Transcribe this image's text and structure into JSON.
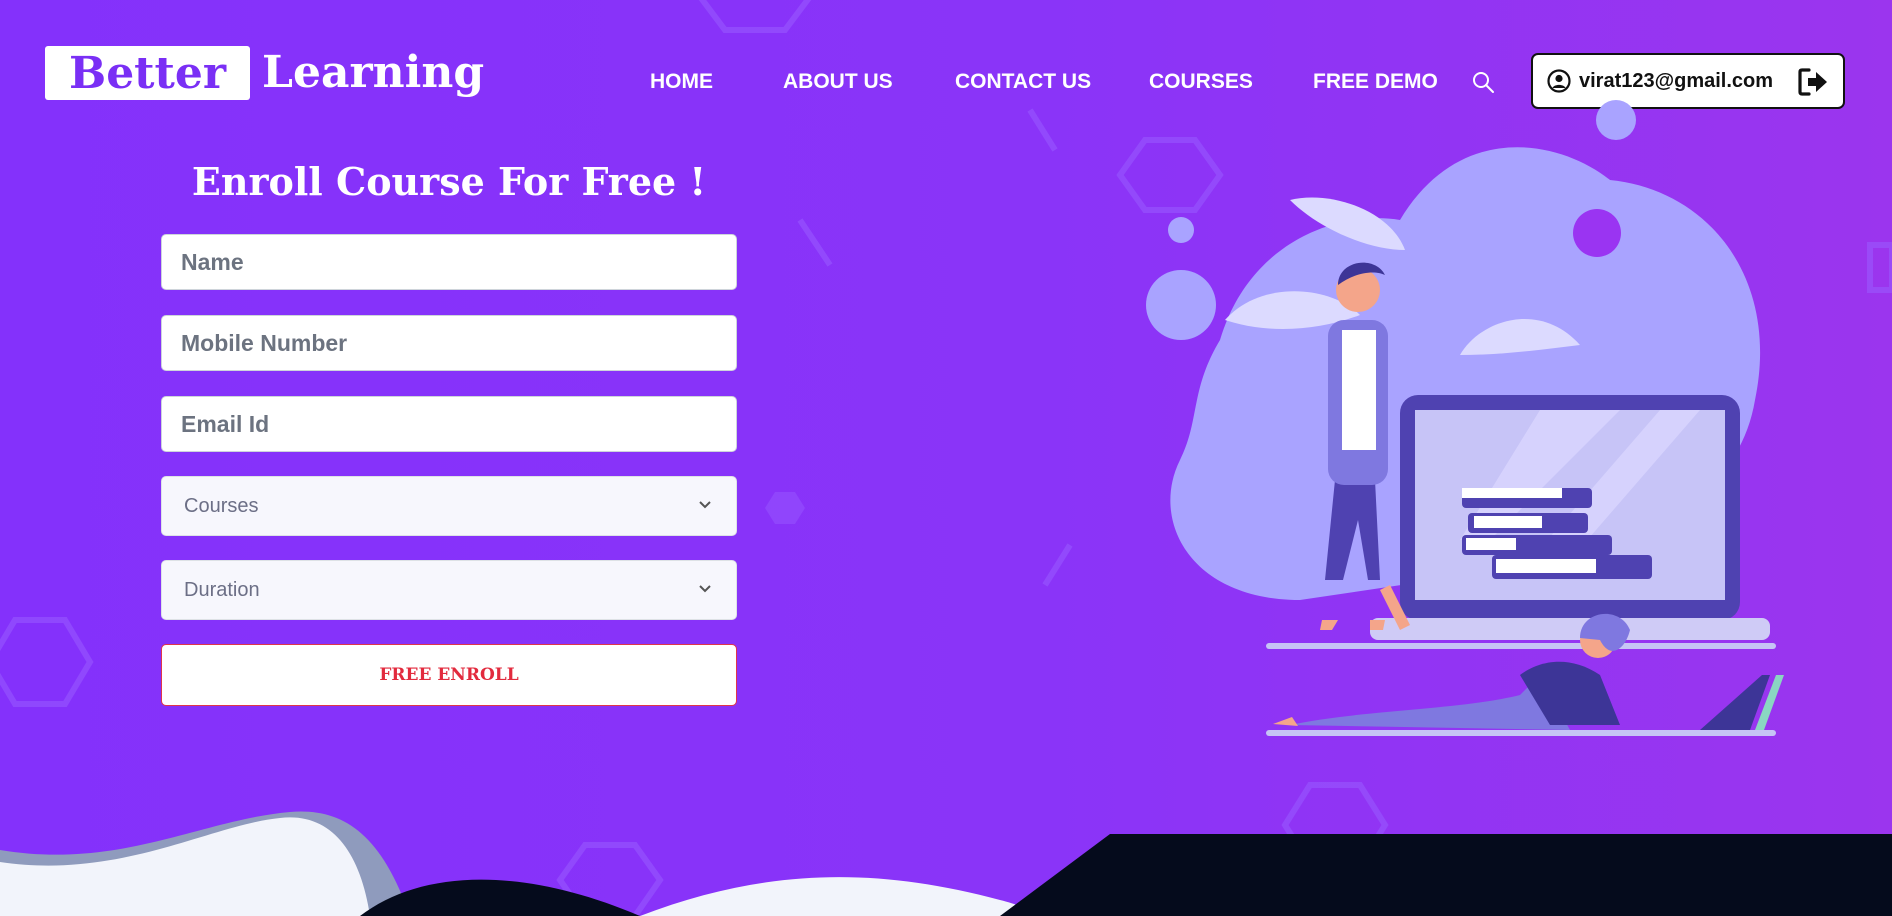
{
  "brand": {
    "part1": "Better",
    "part2": "Learning"
  },
  "nav": {
    "items": [
      {
        "label": "HOME"
      },
      {
        "label": "ABOUT US"
      },
      {
        "label": "CONTACT US"
      },
      {
        "label": "COURSES"
      },
      {
        "label": "FREE DEMO"
      }
    ]
  },
  "user": {
    "email": "virat123@gmail.com"
  },
  "form": {
    "title": "Enroll Course For Free !",
    "name_placeholder": "Name",
    "mobile_placeholder": "Mobile Number",
    "email_placeholder": "Email Id",
    "courses_selected": "Courses",
    "duration_selected": "Duration",
    "submit_label": "FREE ENROLL"
  },
  "icons": {
    "search": "search-icon",
    "user": "user-circle-icon",
    "logout": "logout-icon",
    "chevron": "chevron-down-icon"
  },
  "colors": {
    "background": "#8431fb",
    "brand_purple": "#7a2ff5",
    "submit_text": "#e22a3d",
    "footer_dark": "#050b1c"
  }
}
